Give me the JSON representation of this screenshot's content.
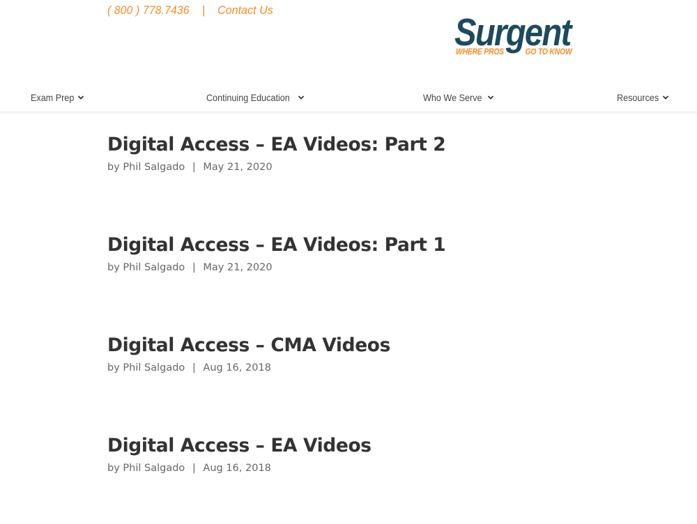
{
  "header": {
    "phone": "( 800 ) 778.7436",
    "separator": "|",
    "contact_label": "Contact Us",
    "logo": {
      "wordmark": "Surgent",
      "tagline_left": "WHERE PROS",
      "tagline_right": "GO TO KNOW"
    },
    "accent_color": "#f38b2a",
    "brand_color": "#1d4a5c"
  },
  "nav": {
    "items": [
      {
        "label": "Exam Prep",
        "icon": "chevron-down-icon"
      },
      {
        "label": "Continuing Education",
        "icon": "chevron-down-icon"
      },
      {
        "label": "Who We Serve",
        "icon": "chevron-down-icon"
      },
      {
        "label": "Resources",
        "icon": "chevron-down-icon"
      }
    ]
  },
  "posts": [
    {
      "title": "Digital Access – EA Videos: Part 2",
      "by": "by",
      "author": "Phil Salgado",
      "separator": "|",
      "date": "May 21, 2020"
    },
    {
      "title": "Digital Access – EA Videos: Part 1",
      "by": "by",
      "author": "Phil Salgado",
      "separator": "|",
      "date": "May 21, 2020"
    },
    {
      "title": "Digital Access – CMA Videos",
      "by": "by",
      "author": "Phil Salgado",
      "separator": "|",
      "date": "Aug 16, 2018"
    },
    {
      "title": "Digital Access – EA Videos",
      "by": "by",
      "author": "Phil Salgado",
      "separator": "|",
      "date": "Aug 16, 2018"
    }
  ]
}
